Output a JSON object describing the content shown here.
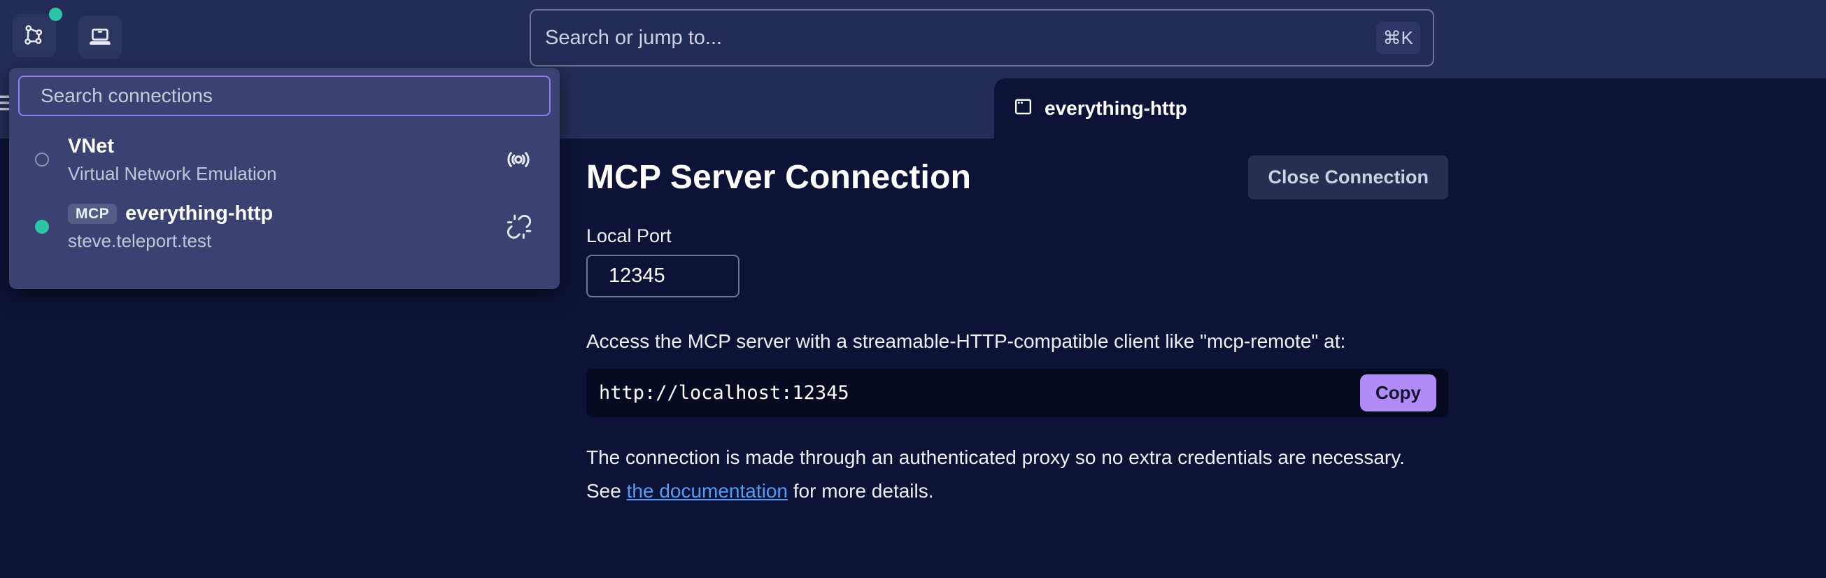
{
  "theme": {
    "topbar_bg": "#232c56",
    "content_bg": "#0d1336",
    "dropdown_bg": "#3b4272",
    "dropdown_input_border": "#917df0",
    "status_teal": "#2cc6a6",
    "code_block_bg": "#050a21",
    "copy_button_bg": "#b18cf8",
    "link_color": "#4d9ef8"
  },
  "topbar": {
    "search_placeholder": "Search or jump to...",
    "shortcut_hint": "⌘K"
  },
  "connections_dropdown": {
    "search_placeholder": "Search connections",
    "items": [
      {
        "title": "VNet",
        "subtitle": "Virtual Network Emulation",
        "status": "inactive",
        "right_icon": "broadcast-icon"
      },
      {
        "badge": "MCP",
        "title": "everything-http",
        "subtitle": "steve.teleport.test",
        "status": "connected",
        "right_icon": "unlink-icon"
      }
    ]
  },
  "tabs": [
    {
      "label": "everything-http",
      "icon": "window-icon",
      "active": true
    }
  ],
  "main": {
    "title": "MCP Server Connection",
    "close_button_label": "Close Connection",
    "local_port_label": "Local Port",
    "local_port_value": "12345",
    "access_text": "Access the MCP server with a streamable-HTTP-compatible client like \"mcp-remote\" at:",
    "endpoint_url": "http://localhost:12345",
    "copy_button_label": "Copy",
    "note_line1": "The connection is made through an authenticated proxy so no extra credentials are necessary.",
    "note_line2_prefix": "See ",
    "note_link_text": "the documentation",
    "note_line2_suffix": " for more details."
  }
}
